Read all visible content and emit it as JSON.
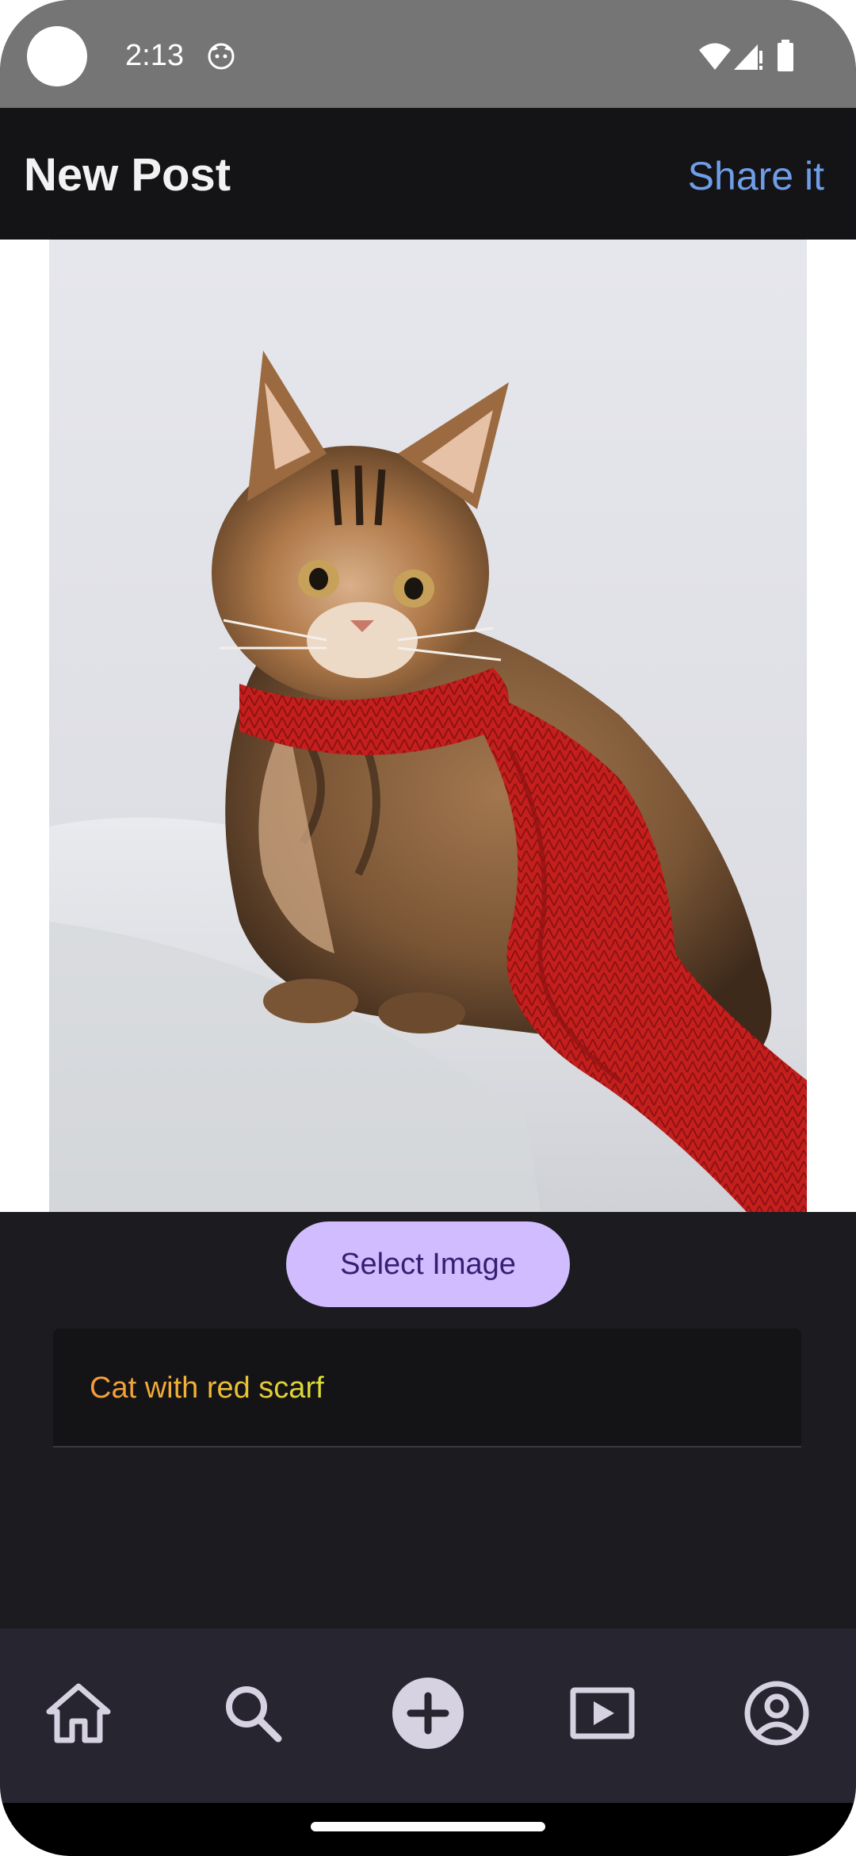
{
  "status_bar": {
    "time": "2:13",
    "icons": [
      "camera-dot",
      "cat-face-icon",
      "wifi-icon",
      "signal-icon",
      "battery-icon"
    ]
  },
  "app_bar": {
    "title": "New Post",
    "share_label": "Share it"
  },
  "image": {
    "subject": "cat-photo"
  },
  "select_image_label": "Select Image",
  "caption": {
    "value": "Cat with red scarf"
  },
  "bottom_nav": {
    "items": [
      "home-icon",
      "search-icon",
      "add-icon",
      "video-icon",
      "profile-icon"
    ]
  },
  "colors": {
    "accent_link": "#6e9ee8",
    "button_bg": "#d0bcff",
    "button_text": "#381e72",
    "background": "#1c1b1f",
    "nav_bg": "#27252f",
    "scarf_red": "#c8201e"
  }
}
